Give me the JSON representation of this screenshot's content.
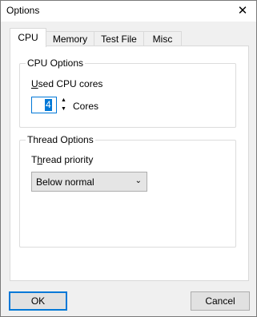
{
  "window": {
    "title": "Options",
    "close_glyph": "✕"
  },
  "tabs": [
    {
      "label": "CPU",
      "active": true
    },
    {
      "label": "Memory",
      "active": false
    },
    {
      "label": "Test File",
      "active": false
    },
    {
      "label": "Misc",
      "active": false
    }
  ],
  "cpu_options": {
    "group_label": "CPU Options",
    "used_cores_label": "Used CPU cores",
    "cores_value": "4",
    "cores_unit": "Cores",
    "spin_up_glyph": "▲",
    "spin_down_glyph": "▼"
  },
  "thread_options": {
    "group_label": "Thread Options",
    "priority_label": "Thread priority",
    "priority_value": "Below normal",
    "chevron_glyph": "⌄"
  },
  "footer": {
    "ok_label": "OK",
    "cancel_label": "Cancel"
  },
  "colors": {
    "accent": "#0078d7",
    "window_bg": "#f0f0f0",
    "panel_bg": "#ffffff"
  }
}
